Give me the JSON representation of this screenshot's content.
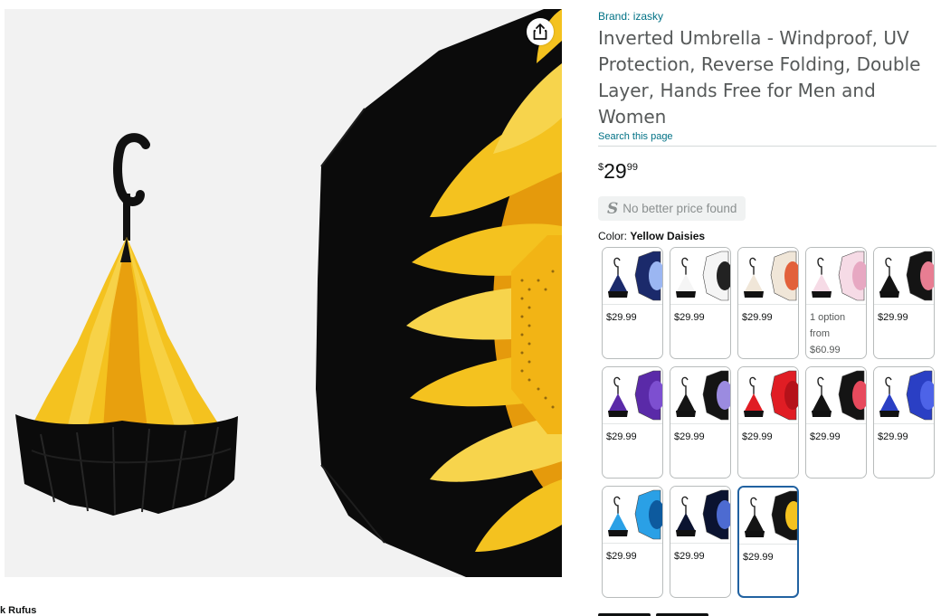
{
  "product": {
    "brand": "Brand: izasky",
    "title": "Inverted Umbrella - Windproof, UV Protection, Reverse Folding, Double Layer, Hands Free for Men and Women",
    "search_link": "Search this page",
    "price": {
      "symbol": "$",
      "whole": "29",
      "fraction": "99"
    },
    "badge": {
      "glyph": "S",
      "text": "No better price found"
    },
    "color": {
      "label": "Color:",
      "selected": "Yellow Daisies"
    }
  },
  "gallery": {
    "share_icon": "share-icon",
    "rufus_label": "k Rufus",
    "main_colors": {
      "petal": "#f4c21f",
      "petal_dark": "#e59a0c",
      "canopy": "#0b0b0b",
      "background": "#f2f2f2"
    }
  },
  "swatches": [
    {
      "price": "$29.99",
      "canopy": "#1b2a6b",
      "accent": "#9bb6f2",
      "selected": false
    },
    {
      "price": "$29.99",
      "canopy": "#f5f5f5",
      "accent": "#222222",
      "selected": false
    },
    {
      "price": "$29.99",
      "canopy": "#f0e6d8",
      "accent": "#e2613b",
      "selected": false
    },
    {
      "price_lines": [
        "1 option",
        "from",
        "$60.99"
      ],
      "canopy": "#f6dbe6",
      "accent": "#e7a8c2",
      "selected": false
    },
    {
      "price": "$29.99",
      "canopy": "#141414",
      "accent": "#e87d92",
      "selected": false
    },
    {
      "price": "$29.99",
      "canopy": "#5a2aa8",
      "accent": "#7d4fd0",
      "selected": false
    },
    {
      "price": "$29.99",
      "canopy": "#141414",
      "accent": "#9b8be0",
      "selected": false
    },
    {
      "price": "$29.99",
      "canopy": "#e01d24",
      "accent": "#b5121a",
      "selected": false
    },
    {
      "price": "$29.99",
      "canopy": "#141414",
      "accent": "#e74a5d",
      "selected": false
    },
    {
      "price": "$29.99",
      "canopy": "#2a3fc4",
      "accent": "#4d63e8",
      "selected": false
    },
    {
      "price": "$29.99",
      "canopy": "#2aa0e6",
      "accent": "#0d5a9e",
      "selected": false
    },
    {
      "price": "$29.99",
      "canopy": "#0b1330",
      "accent": "#4d6bd1",
      "selected": false
    },
    {
      "price": "$29.99",
      "canopy": "#141414",
      "accent": "#f4c21f",
      "selected": true
    }
  ]
}
